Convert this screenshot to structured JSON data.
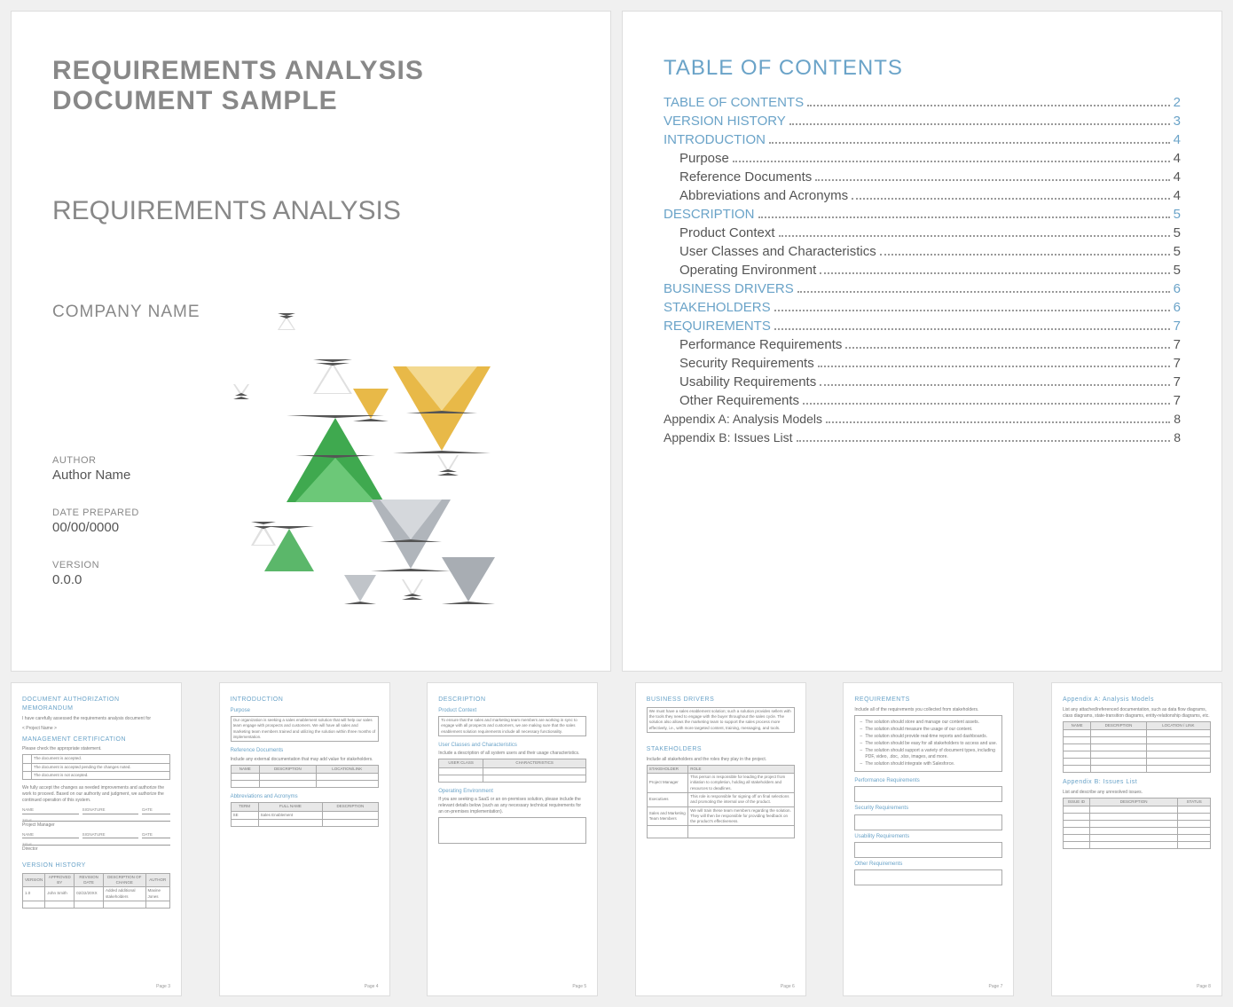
{
  "cover": {
    "title_line1": "REQUIREMENTS ANALYSIS",
    "title_line2": "DOCUMENT SAMPLE",
    "subtitle": "REQUIREMENTS ANALYSIS",
    "company": "COMPANY NAME",
    "author_label": "AUTHOR",
    "author_value": "Author Name",
    "date_label": "DATE PREPARED",
    "date_value": "00/00/0000",
    "version_label": "VERSION",
    "version_value": "0.0.0"
  },
  "toc": {
    "title": "TABLE OF CONTENTS",
    "items": [
      {
        "label": "TABLE OF CONTENTS",
        "page": "2",
        "level": "h1"
      },
      {
        "label": "VERSION HISTORY",
        "page": "3",
        "level": "h1"
      },
      {
        "label": "INTRODUCTION",
        "page": "4",
        "level": "h1"
      },
      {
        "label": "Purpose",
        "page": "4",
        "level": "h2"
      },
      {
        "label": "Reference Documents",
        "page": "4",
        "level": "h2"
      },
      {
        "label": "Abbreviations and Acronyms",
        "page": "4",
        "level": "h2"
      },
      {
        "label": "DESCRIPTION",
        "page": "5",
        "level": "h1"
      },
      {
        "label": "Product Context",
        "page": "5",
        "level": "h2"
      },
      {
        "label": "User Classes and Characteristics",
        "page": "5",
        "level": "h2"
      },
      {
        "label": "Operating Environment",
        "page": "5",
        "level": "h2"
      },
      {
        "label": "BUSINESS DRIVERS",
        "page": "6",
        "level": "h1"
      },
      {
        "label": "STAKEHOLDERS",
        "page": "6",
        "level": "h1"
      },
      {
        "label": "REQUIREMENTS",
        "page": "7",
        "level": "h1"
      },
      {
        "label": "Performance Requirements",
        "page": "7",
        "level": "h2"
      },
      {
        "label": "Security Requirements",
        "page": "7",
        "level": "h2"
      },
      {
        "label": "Usability Requirements",
        "page": "7",
        "level": "h2"
      },
      {
        "label": "Other Requirements",
        "page": "7",
        "level": "h2"
      },
      {
        "label": "Appendix A:  Analysis Models",
        "page": "8",
        "level": "appendix"
      },
      {
        "label": "Appendix B:  Issues List",
        "page": "8",
        "level": "appendix"
      }
    ]
  },
  "p3": {
    "h_dam": "DOCUMENT AUTHORIZATION MEMORANDUM",
    "line_assessed": "I have carefully assessed the requirements analysis document for",
    "project": "< Project Name >",
    "h_mgmt": "MANAGEMENT CERTIFICATION",
    "line_check": "Please check the appropriate statement.",
    "opt1": "The document is accepted.",
    "opt2": "The document is accepted pending the changes noted.",
    "opt3": "The document is not accepted.",
    "line_accept": "We fully accept the changes as needed improvements and authorize the work to proceed. Based on our authority and judgment, we authorize the continued operation of this system.",
    "sig_name": "NAME",
    "sig_sig": "SIGNATURE",
    "sig_date": "DATE",
    "title_label": "TITLE",
    "role1": "Project Manager",
    "role2": "Director",
    "h_version": "VERSION HISTORY",
    "vh_version": "VERSION",
    "vh_approved": "APPROVED BY",
    "vh_revdate": "REVISION DATE",
    "vh_desc": "DESCRIPTION OF CHANGE",
    "vh_author": "AUTHOR",
    "vh_r1_v": "1.0",
    "vh_r1_a": "John Smith",
    "vh_r1_d": "02/22/20XX",
    "vh_r1_desc": "Added additional stakeholders",
    "vh_r1_auth": "Maxine Jones",
    "footer": "Page 3"
  },
  "p4": {
    "h_intro": "INTRODUCTION",
    "h_purpose": "Purpose",
    "purpose_txt": "Our organization is seeking a sales enablement solution that will help our sales team engage with prospects and customers. We will have all sales and marketing team members trained and utilizing the solution within three months of implementation.",
    "h_refdocs": "Reference Documents",
    "refdocs_txt": "Include any external documentation that may add value for stakeholders.",
    "th_name": "NAME",
    "th_desc": "DESCRIPTION",
    "th_loc": "LOCATION/LINK",
    "h_abbrev": "Abbreviations and Acronyms",
    "th_term": "TERM",
    "th_full": "FULL NAME",
    "th_desc2": "DESCRIPTION",
    "abbrev_r1_term": "SE",
    "abbrev_r1_full": "Sales Enablement",
    "footer": "Page 4"
  },
  "p5": {
    "h_desc": "DESCRIPTION",
    "h_context": "Product Context",
    "context_txt": "To ensure that the sales and marketing team members are working in sync to engage with all prospects and customers, we are making sure that the sales enablement solution requirements include all necessary functionality.",
    "h_users": "User Classes and Characteristics",
    "users_txt": "Include a description of all system users and their usage characteristics.",
    "th_userclass": "USER CLASS",
    "th_char": "CHARACTERISTICS",
    "h_opEnv": "Operating Environment",
    "opEnv_txt": "If you are seeking a SaaS or an on-premises solution, please include the relevant details below (such as any necessary technical requirements for an on-premises implementation).",
    "footer": "Page 5"
  },
  "p6": {
    "h_bd": "BUSINESS DRIVERS",
    "bd_txt": "We must have a sales enablement solution; such a solution provides sellers with the tools they need to engage with the buyer throughout the sales cycle. The solution also allows the marketing team to support the sales process more effectively, i.e., with more targeted content, training, messaging, and tools.",
    "h_stake": "STAKEHOLDERS",
    "stake_txt": "Include all stakeholders and the roles they play in the project.",
    "th_stake": "STAKEHOLDER",
    "th_role": "ROLE",
    "r1_s": "Project Manager",
    "r1_r": "This person is responsible for leading the project from initiation to completion, holding all stakeholders and resources to deadlines.",
    "r2_s": "Executives",
    "r2_r": "This role is responsible for signing off on final selections and promoting the internal use of the product.",
    "r3_s": "Sales and Marketing Team Members",
    "r3_r": "We will train these team members regarding the solution. They will then be responsible for providing feedback on the product's effectiveness.",
    "footer": "Page 6"
  },
  "p7": {
    "h_req": "REQUIREMENTS",
    "req_txt": "Include all of the requirements you collected from stakeholders.",
    "b1": "The solution should store and manage our content assets.",
    "b2": "The solution should measure the usage of our content.",
    "b3": "The solution should provide real-time reports and dashboards.",
    "b4": "The solution should be easy for all stakeholders to access and use.",
    "b5": "The solution should support a variety of document types, including PDF, video, .doc, .xlsx, images, and more.",
    "b6": "The solution should integrate with Salesforce.",
    "h_perf": "Performance Requirements",
    "h_sec": "Security Requirements",
    "h_use": "Usability Requirements",
    "h_other": "Other Requirements",
    "footer": "Page 7"
  },
  "p8": {
    "h_apA": "Appendix A:  Analysis Models",
    "apA_txt": "List any attached/referenced documentation, such as data flow diagrams, class diagrams, state-transition diagrams, entity-relationship diagrams, etc.",
    "th_name": "NAME",
    "th_desc": "DESCRIPTION",
    "th_loc": "LOCATION / LINK",
    "h_apB": "Appendix B:  Issues List",
    "apB_txt": "List and describe any unresolved issues.",
    "th_id": "ISSUE ID",
    "th_desc2": "DESCRIPTION",
    "th_status": "STATUS",
    "footer": "Page 8"
  }
}
